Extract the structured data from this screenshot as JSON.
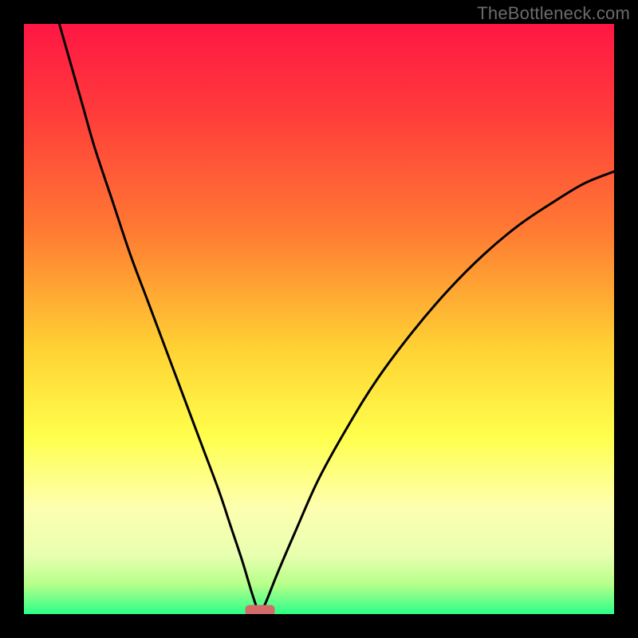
{
  "watermark": "TheBottleneck.com",
  "chart_data": {
    "type": "line",
    "title": "",
    "xlabel": "",
    "ylabel": "",
    "xlim": [
      0,
      100
    ],
    "ylim": [
      0,
      100
    ],
    "optimum_x": 40,
    "gradient_stops": [
      {
        "offset": 0.0,
        "color": "#ff1744"
      },
      {
        "offset": 0.15,
        "color": "#ff3b3b"
      },
      {
        "offset": 0.35,
        "color": "#ff7a33"
      },
      {
        "offset": 0.55,
        "color": "#ffd233"
      },
      {
        "offset": 0.7,
        "color": "#ffff4d"
      },
      {
        "offset": 0.82,
        "color": "#fdffb0"
      },
      {
        "offset": 0.9,
        "color": "#e9ffb0"
      },
      {
        "offset": 0.95,
        "color": "#b6ff8a"
      },
      {
        "offset": 1.0,
        "color": "#2bff88"
      }
    ],
    "series": [
      {
        "name": "left-branch",
        "x": [
          6,
          8,
          10,
          12,
          15,
          18,
          21,
          24,
          27,
          30,
          33,
          35,
          37,
          38.5,
          39.5,
          40
        ],
        "y": [
          100,
          93,
          86,
          79,
          70,
          61,
          53,
          45,
          37,
          29,
          21,
          15,
          9,
          4,
          1,
          0
        ]
      },
      {
        "name": "right-branch",
        "x": [
          40,
          41,
          43,
          46,
          50,
          55,
          60,
          66,
          72,
          78,
          84,
          90,
          95,
          100
        ],
        "y": [
          0,
          2,
          7,
          14,
          23,
          32,
          40,
          48,
          55,
          61,
          66,
          70,
          73,
          75
        ]
      }
    ],
    "marker": {
      "x": 40,
      "y": 0,
      "width": 5,
      "height": 1.8,
      "color": "#d46a6a"
    }
  }
}
